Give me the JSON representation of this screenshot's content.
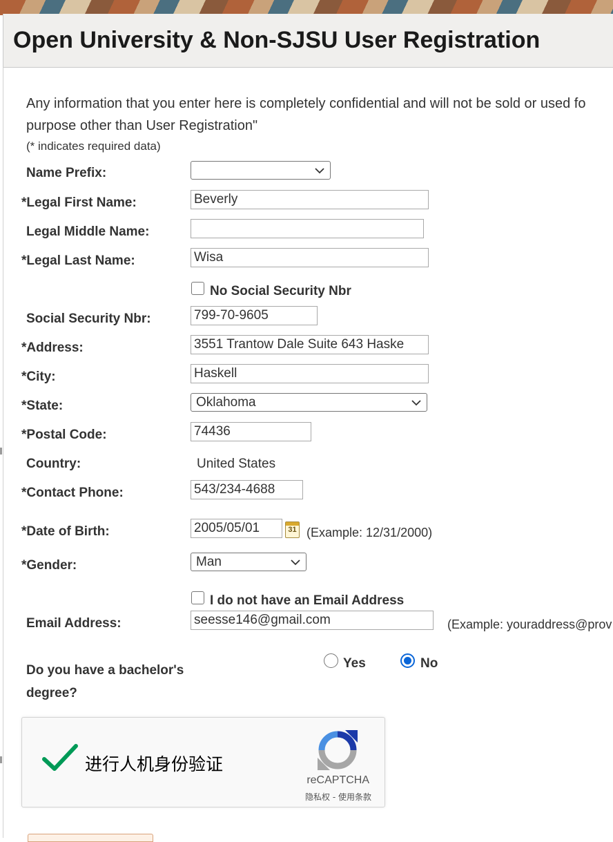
{
  "page": {
    "title": "Open University & Non-SJSU User Registration",
    "intro_line1": "Any information that you enter here is completely confidential and will not be sold or used fo",
    "intro_line2": "purpose other than User Registration\"",
    "required_note": "(* indicates required data)"
  },
  "form": {
    "name_prefix": {
      "label": "Name Prefix:",
      "value": ""
    },
    "first_name": {
      "label": "*Legal First Name:",
      "value": "Beverly"
    },
    "middle_name": {
      "label": "Legal Middle Name:",
      "value": ""
    },
    "last_name": {
      "label": "*Legal Last Name:",
      "value": "Wisa"
    },
    "no_ssn": {
      "label": "No Social Security Nbr",
      "checked": false
    },
    "ssn": {
      "label": "Social Security Nbr:",
      "value": "799-70-9605"
    },
    "address": {
      "label": "*Address:",
      "value": "3551 Trantow Dale Suite 643 Haske"
    },
    "city": {
      "label": "*City:",
      "value": "Haskell"
    },
    "state": {
      "label": "*State:",
      "value": "Oklahoma"
    },
    "postal_code": {
      "label": "*Postal Code:",
      "value": "74436"
    },
    "country": {
      "label": "Country:",
      "value": "United States"
    },
    "phone": {
      "label": "*Contact Phone:",
      "value": "543/234-4688"
    },
    "dob": {
      "label": "*Date of Birth:",
      "value": "2005/05/01",
      "calendar_text": "31",
      "example": "(Example: 12/31/2000)"
    },
    "gender": {
      "label": "*Gender:",
      "value": "Man"
    },
    "no_email": {
      "label": "I do not have an Email Address",
      "checked": false
    },
    "email": {
      "label": "Email Address:",
      "value": "seesse146@gmail.com",
      "example": "(Example: youraddress@prov"
    },
    "bachelor": {
      "label_line1": "Do you have a bachelor's",
      "label_line2": "degree?",
      "yes_label": "Yes",
      "no_label": "No",
      "selected": "No"
    }
  },
  "recaptcha": {
    "text": "进行人机身份验证",
    "brand": "reCAPTCHA",
    "links": "隐私权 - 使用条款",
    "checkmark_color": "#009a57"
  },
  "colors": {
    "accent": "#0a66d8",
    "title_bg": "#f0efed"
  }
}
